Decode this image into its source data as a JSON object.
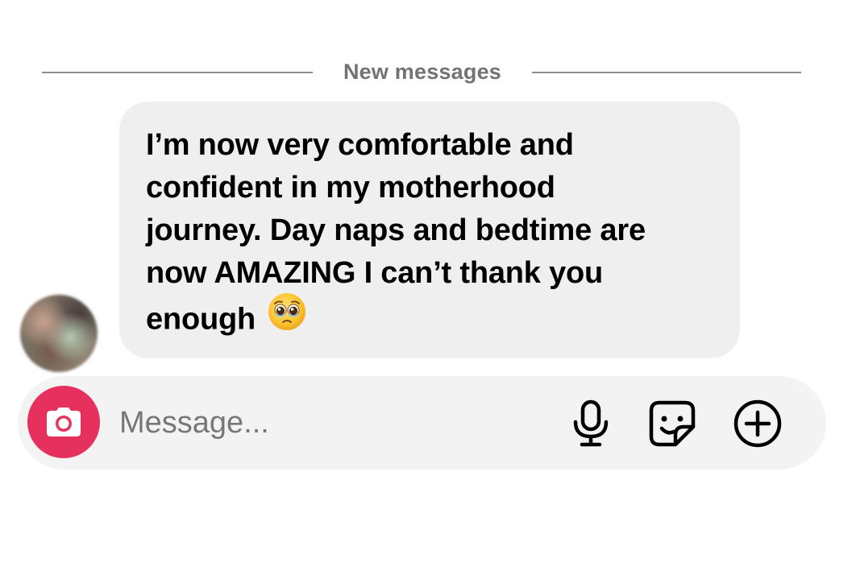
{
  "divider": {
    "label": "New messages"
  },
  "message": {
    "lines": [
      "I’m now very comfortable and",
      "confident in my motherhood",
      "journey. Day naps and bedtime are",
      "now AMAZING I can’t thank you",
      "enough"
    ],
    "emoji": "pleading-face-emoji"
  },
  "composer": {
    "placeholder": "Message...",
    "value": "",
    "icons": {
      "camera": "camera-icon",
      "mic": "microphone-icon",
      "sticker": "sticker-icon",
      "plus": "plus-circle-icon"
    },
    "camera_color": "#e6315e"
  },
  "colors": {
    "bubble": "#efefef",
    "divider_text": "#737373",
    "composer_bg": "#f3f3f3"
  }
}
